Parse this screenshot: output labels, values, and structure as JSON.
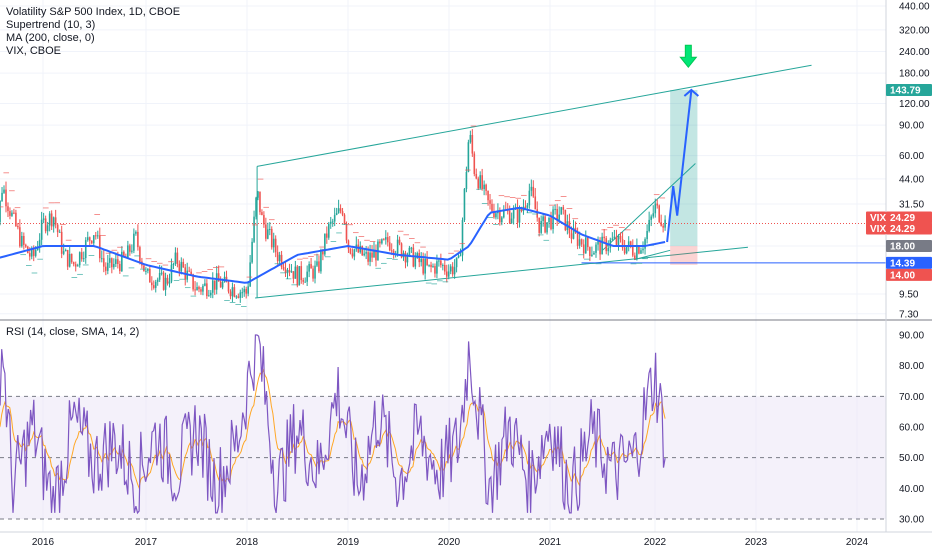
{
  "chart_data": [
    {
      "type": "line",
      "title": "Volatility S&P 500 Index, 1D, CBOE",
      "legend": [
        "Volatility S&P 500 Index, 1D, CBOE",
        "Supertrend (10, 3)",
        "MA (200, close, 0)",
        "VIX, CBOE"
      ],
      "scale": "log",
      "ylim": [
        7.3,
        440
      ],
      "y_ticks": [
        "440.00",
        "320.00",
        "240.00",
        "180.00",
        "120.00",
        "90.00",
        "60.00",
        "44.00",
        "31.50",
        "18.00",
        "9.50",
        "7.30"
      ],
      "x_ticks": [
        "2016",
        "2017",
        "2018",
        "2019",
        "2020",
        "2021",
        "2022",
        "2023",
        "2024"
      ],
      "series": [
        {
          "name": "VIX, CBOE",
          "x": [
            2015.5,
            2015.6,
            2015.7,
            2015.8,
            2015.9,
            2016.0,
            2016.1,
            2016.2,
            2016.3,
            2016.5,
            2016.6,
            2016.8,
            2016.9,
            2017.0,
            2017.2,
            2017.3,
            2017.5,
            2017.7,
            2017.9,
            2018.0,
            2018.1,
            2018.15,
            2018.3,
            2018.5,
            2018.7,
            2018.8,
            2018.95,
            2019.0,
            2019.2,
            2019.4,
            2019.6,
            2019.8,
            2019.9,
            2020.0,
            2020.1,
            2020.2,
            2020.25,
            2020.4,
            2020.5,
            2020.7,
            2020.8,
            2020.9,
            2021.0,
            2021.1,
            2021.2,
            2021.4,
            2021.6,
            2021.8,
            2021.9,
            2022.0,
            2022.1
          ],
          "values": [
            13,
            40,
            26,
            18,
            15,
            24,
            27,
            16,
            14,
            22,
            13,
            15,
            20,
            12,
            11,
            15,
            10,
            11,
            10,
            9.5,
            37,
            25,
            16,
            12,
            13,
            22,
            30,
            18,
            15,
            19,
            16,
            13,
            14,
            13,
            14,
            82,
            50,
            30,
            28,
            27,
            38,
            23,
            25,
            28,
            21,
            17,
            19,
            17,
            19,
            30,
            24.29
          ]
        },
        {
          "name": "MA (200, close, 0)",
          "x": [
            2015.5,
            2016.0,
            2016.5,
            2017.0,
            2017.5,
            2018.0,
            2018.5,
            2019.0,
            2019.5,
            2020.0,
            2020.2,
            2020.4,
            2020.7,
            2021.0,
            2021.3,
            2021.6,
            2021.9,
            2022.1
          ],
          "values": [
            15,
            18,
            18,
            14,
            12,
            11,
            16,
            18,
            16,
            15,
            18,
            28,
            30,
            27,
            21,
            18,
            18,
            19
          ]
        }
      ],
      "annotations": [
        {
          "label": "143.79",
          "value": 143.79,
          "color": "#26a69a"
        },
        {
          "label": "VIX",
          "value": 24.29,
          "color": "#ef5350"
        },
        {
          "label": "VIX",
          "value": 24.29,
          "color": "#ef5350"
        },
        {
          "label": "24.29",
          "value": 24.29,
          "color": "#ef5350"
        },
        {
          "label": "24.29",
          "value": 24.29,
          "color": "#ef5350"
        },
        {
          "label": "18.00",
          "value": 18.0,
          "color": "#787b86"
        },
        {
          "label": "14.39",
          "value": 14.39,
          "color": "#2962ff"
        },
        {
          "label": "14.00",
          "value": 14.0,
          "color": "#ef5350"
        }
      ],
      "colors": {
        "up": "#26a69a",
        "down": "#ef5350",
        "ma": "#2962ff",
        "channel": "#26a69a",
        "projection": "#2962ff",
        "arrow": "#00e676"
      }
    },
    {
      "type": "line",
      "title": "RSI (14, close, SMA, 14, 2)",
      "ylim": [
        27,
        92
      ],
      "y_ticks": [
        "90.00",
        "80.00",
        "70.00",
        "60.00",
        "50.00",
        "40.00",
        "30.00"
      ],
      "bands": {
        "upper": 70,
        "middle": 50,
        "lower": 30
      },
      "series": [
        {
          "name": "RSI",
          "x": [
            2015.5,
            2015.6,
            2015.7,
            2015.9,
            2016.1,
            2016.3,
            2016.5,
            2016.7,
            2016.9,
            2017.1,
            2017.3,
            2017.5,
            2017.7,
            2017.9,
            2018.1,
            2018.3,
            2018.5,
            2018.7,
            2018.9,
            2019.1,
            2019.3,
            2019.5,
            2019.7,
            2019.9,
            2020.1,
            2020.2,
            2020.4,
            2020.6,
            2020.8,
            2021.0,
            2021.2,
            2021.4,
            2021.6,
            2021.8,
            2022.0,
            2022.1
          ],
          "values": [
            50,
            88,
            40,
            60,
            35,
            62,
            48,
            55,
            42,
            58,
            45,
            60,
            40,
            55,
            90,
            40,
            60,
            45,
            72,
            40,
            65,
            42,
            58,
            45,
            55,
            86,
            40,
            60,
            42,
            62,
            38,
            58,
            45,
            50,
            78,
            55
          ]
        }
      ],
      "colors": {
        "line": "#7e57c2",
        "sma": "#ffa726",
        "band": "#ede7f6"
      }
    }
  ]
}
